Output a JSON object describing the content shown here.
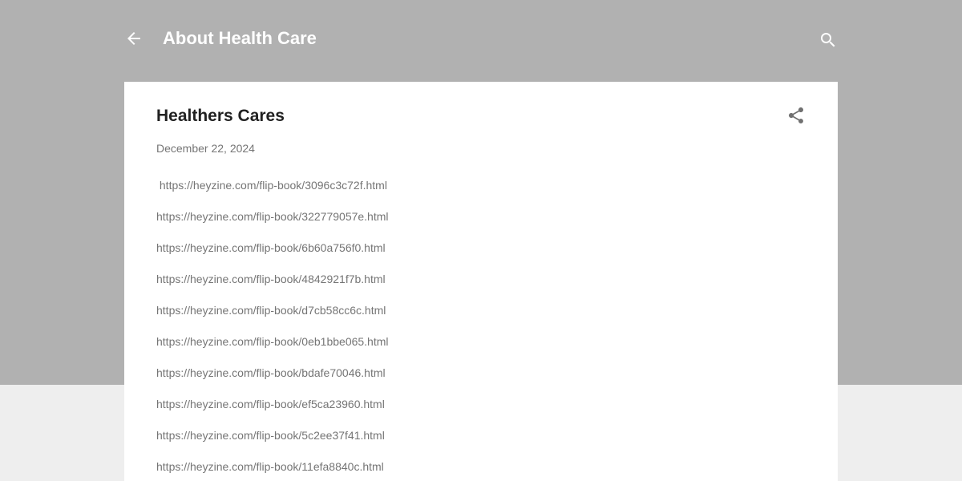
{
  "header": {
    "title": "About Health Care",
    "back_icon": "arrow-back-icon",
    "search_icon": "search-icon",
    "background_color": "#b1b1b1",
    "page_background_color": "#eeeeee"
  },
  "post": {
    "title": "Healthers Cares",
    "date": "December 22, 2024",
    "share_icon": "share-icon",
    "links": [
      " https://heyzine.com/flip-book/3096c3c72f.html",
      "https://heyzine.com/flip-book/322779057e.html",
      "https://heyzine.com/flip-book/6b60a756f0.html",
      "https://heyzine.com/flip-book/4842921f7b.html",
      "https://heyzine.com/flip-book/d7cb58cc6c.html",
      "https://heyzine.com/flip-book/0eb1bbe065.html",
      "https://heyzine.com/flip-book/bdafe70046.html",
      "https://heyzine.com/flip-book/ef5ca23960.html",
      "https://heyzine.com/flip-book/5c2ee37f41.html",
      "https://heyzine.com/flip-book/11efa8840c.html"
    ]
  }
}
